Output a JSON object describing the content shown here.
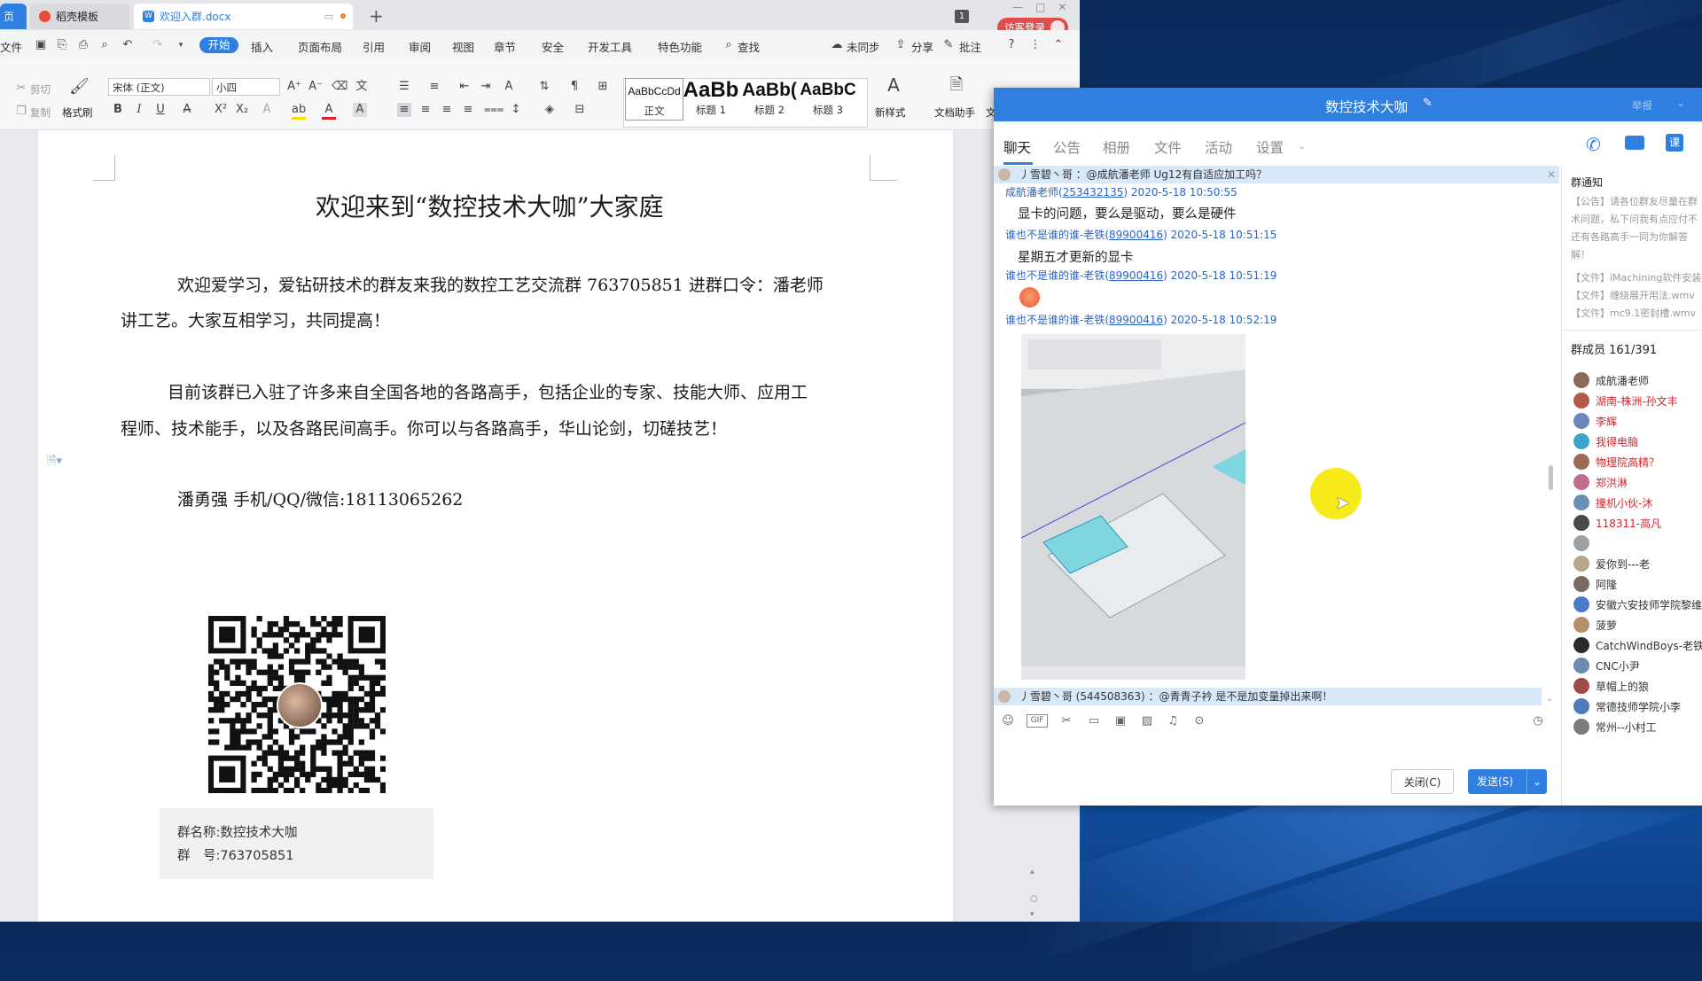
{
  "wps": {
    "tabs": {
      "home_partial": "页",
      "template_tab": "稻壳模板",
      "doc_tab": "欢迎入群.docx",
      "visitor_login": "访客登录",
      "badge_count": "1"
    },
    "menu": {
      "file_partial": "文件",
      "start": "开始",
      "items": [
        "插入",
        "页面布局",
        "引用",
        "审阅",
        "视图",
        "章节",
        "安全",
        "开发工具",
        "特色功能"
      ],
      "search": "查找",
      "unsynced": "未同步",
      "share": "分享",
      "comment": "批注"
    },
    "toolbar": {
      "cut": "剪切",
      "copy": "复制",
      "format_painter": "格式刷",
      "font_name": "宋体 (正文)",
      "font_size": "小四",
      "styles": [
        {
          "preview": "AaBbCcDd",
          "label": "正文"
        },
        {
          "preview": "AaBb",
          "label": "标题 1"
        },
        {
          "preview": "AaBb(",
          "label": "标题 2"
        },
        {
          "preview": "AaBbC",
          "label": "标题 3"
        }
      ],
      "new_style": "新样式",
      "doc_assistant": "文档助手",
      "partial_more": "文"
    },
    "document": {
      "title": "欢迎来到“数控技术大咖”大家庭",
      "p1_line1": "欢迎爱学习，爱钻研技术的群友来我的数控工艺交流群 763705851 进群口令：潘老师",
      "p1_line2": "讲工艺。大家互相学习，共同提高！",
      "p2_line1": "目前该群已入驻了许多来自全国各地的各路高手，包括企业的专家、技能大师、应用工",
      "p2_line2": "程师、技术能手，以及各路民间高手。你可以与各路高手，华山论剑，切磋技艺！",
      "contact": "潘勇强 手机/QQ/微信:18113065262",
      "qr_group_name": "群名称:数控技术大咖",
      "qr_group_no": "群　号:763705851"
    }
  },
  "qq": {
    "title": "数控技术大咖",
    "nav_tabs": [
      "聊天",
      "公告",
      "相册",
      "文件",
      "活动",
      "设置"
    ],
    "top_right_partial": "举报",
    "pinned_notice": "丿雪碧丶哥 ：@成航潘老师   Ug12有自适应加工吗？",
    "messages": [
      {
        "sender": "成航潘老师",
        "qq": "253432135",
        "time": "2020-5-18 10:50:55",
        "text": "显卡的问题，要么是驱动，要么是硬件"
      },
      {
        "sender": "谁也不是谁的谁-老铁",
        "qq": "89900416",
        "time": "2020-5-18 10:51:15",
        "text": "星期五才更新的显卡"
      },
      {
        "sender": "谁也不是谁的谁-老铁",
        "qq": "89900416",
        "time": "2020-5-18 10:51:19",
        "text": ""
      },
      {
        "sender": "谁也不是谁的谁-老铁",
        "qq": "89900416",
        "time": "2020-5-18 10:52:19",
        "text": ""
      }
    ],
    "bottom_notice": "丿雪碧丶哥 (544508363) ：@青青子衿   是不是加变量掉出来啊！",
    "close_button": "关闭(C)",
    "send_button": "发送(S)",
    "side": {
      "notice_heading": "群通知",
      "notice_lines": [
        "【公告】请各位群友尽量在群",
        "术问题，私下问我有点应付不",
        "还有各路高手一同为你解答",
        "解！"
      ],
      "file_lines": [
        "【文件】iMachining软件安装",
        "【文件】缠绕展开用法.wmv",
        "【文件】mc9.1密封槽.wmv"
      ],
      "members_heading": "群成员 161/391",
      "members": [
        {
          "name": "成航潘老师",
          "color": "#333333"
        },
        {
          "name": "湖南-株洲-孙文丰",
          "color": "#d2262b"
        },
        {
          "name": "李辉",
          "color": "#d2262b"
        },
        {
          "name": "我得电脑",
          "color": "#d2262b"
        },
        {
          "name": "物理院高精？",
          "color": "#d2262b"
        },
        {
          "name": "郑洪淋",
          "color": "#d2262b"
        },
        {
          "name": "撞机小伙-沐",
          "color": "#d2262b"
        },
        {
          "name": "118311-高凡",
          "color": "#d2262b"
        },
        {
          "name": "",
          "color": "#333333"
        },
        {
          "name": "爱你到---老",
          "color": "#333333"
        },
        {
          "name": "阿隆",
          "color": "#333333"
        },
        {
          "name": "安徽六安技师学院黎维",
          "color": "#333333"
        },
        {
          "name": "菠萝",
          "color": "#333333"
        },
        {
          "name": "CatchWindBoys-老铁",
          "color": "#333333"
        },
        {
          "name": "CNC小尹",
          "color": "#333333"
        },
        {
          "name": "草帽上的狼",
          "color": "#333333"
        },
        {
          "name": "常德技师学院小李",
          "color": "#333333"
        },
        {
          "name": "常州--小村工",
          "color": "#333333"
        }
      ]
    }
  }
}
